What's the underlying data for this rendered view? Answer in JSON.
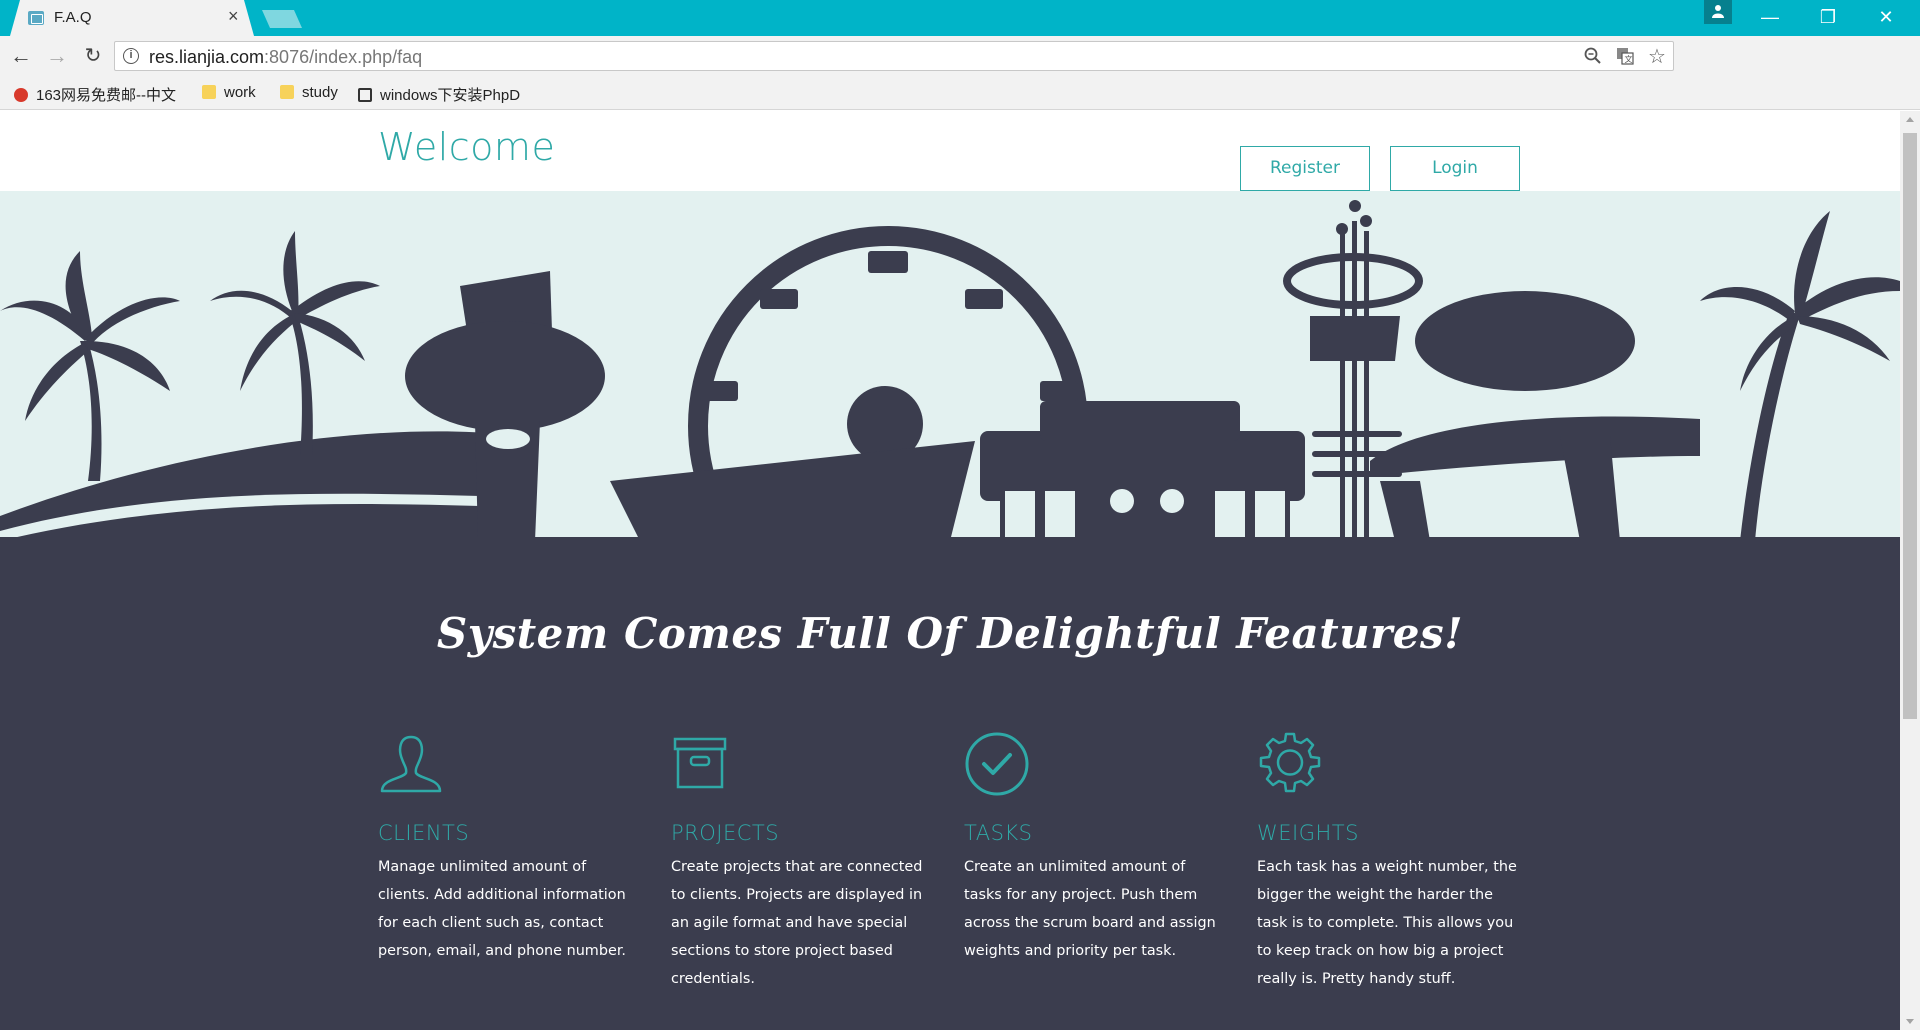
{
  "browser": {
    "tab_title": "F.A.Q",
    "tab_close": "×",
    "url_host": "res.lianjia.com",
    "url_path": ":8076/index.php/faq",
    "bookmarks": [
      {
        "label": "163网易免费邮--中文",
        "icon": "mail-163-icon"
      },
      {
        "label": "work",
        "icon": "folder-icon"
      },
      {
        "label": "study",
        "icon": "folder-icon"
      },
      {
        "label": "windows下安装PhpD",
        "icon": "page-icon"
      }
    ],
    "window_controls": {
      "minimize": "—",
      "maximize": "❐",
      "close": "✕"
    }
  },
  "header": {
    "welcome": "Welcome",
    "register_label": "Register",
    "login_label": "Login"
  },
  "features": {
    "title": "System Comes Full Of Delightful Features!",
    "items": [
      {
        "icon": "user-icon",
        "title": "CLIENTS",
        "desc": "Manage unlimited amount of clients. Add additional information for each client such as, contact person, email, and phone number."
      },
      {
        "icon": "archive-box-icon",
        "title": "PROJECTS",
        "desc": "Create projects that are connected to clients. Projects are displayed in an agile format and have special sections to store project based credentials."
      },
      {
        "icon": "check-circle-icon",
        "title": "TASKS",
        "desc": "Create an unlimited amount of tasks for any project. Push them across the scrum board and assign weights and priority per task."
      },
      {
        "icon": "gear-icon",
        "title": "WEIGHTS",
        "desc": "Each task has a weight number, the bigger the weight the harder the task is to complete. This allows you to keep track on how big a project really is. Pretty handy stuff."
      }
    ]
  },
  "colors": {
    "accent": "#2fa9a7",
    "dark": "#3b3d4e",
    "hero_bg": "#e3f1f0",
    "chrome": "#00b4c8"
  }
}
